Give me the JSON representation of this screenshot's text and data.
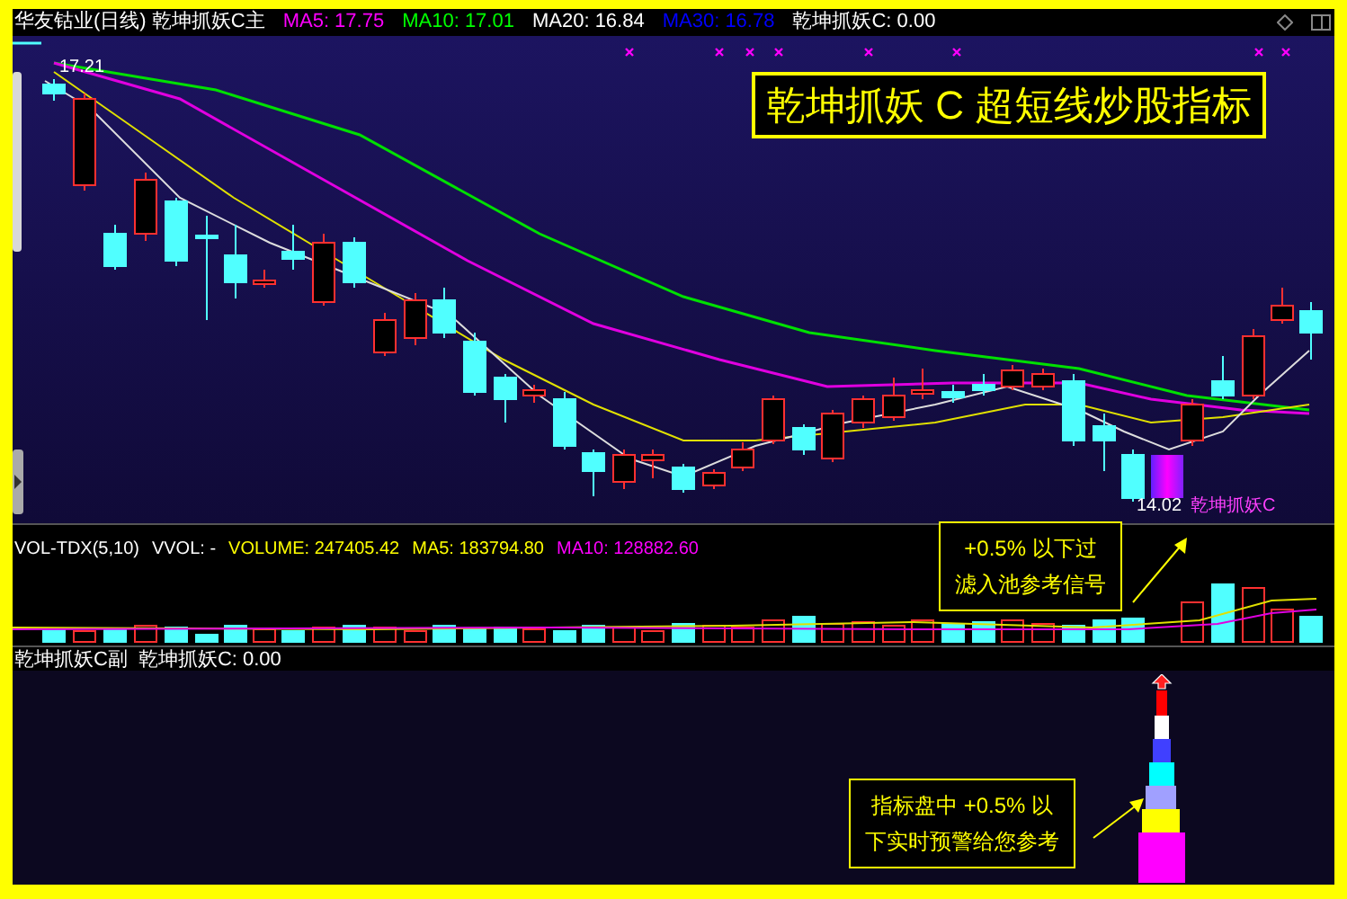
{
  "main_header": {
    "title": "华友钴业(日线) 乾坤抓妖C主",
    "indicators": [
      {
        "label": "MA5: 17.75",
        "color": "#ff00ff"
      },
      {
        "label": "MA10: 17.01",
        "color": "#00ff00"
      },
      {
        "label": "MA20: 16.84",
        "color": "#ffffff"
      },
      {
        "label": "MA30: 16.78",
        "color": "#0000ff"
      },
      {
        "label": "乾坤抓妖C: 0.00",
        "color": "#ffffff"
      }
    ]
  },
  "banner": "乾坤抓妖 C 超短线炒股指标",
  "price_labels": {
    "high": "17.21",
    "low": "14.02",
    "signal": "乾坤抓妖C"
  },
  "volume_header": [
    {
      "label": "VOL-TDX(5,10)",
      "color": "#ffffff"
    },
    {
      "label": "VVOL: -",
      "color": "#ffffff"
    },
    {
      "label": "VOLUME: 247405.42",
      "color": "#ffff00"
    },
    {
      "label": "MA5: 183794.80",
      "color": "#ffff00"
    },
    {
      "label": "MA10: 128882.60",
      "color": "#ff00ff"
    }
  ],
  "note_1": [
    "+0.5% 以下过",
    "滤入池参考信号"
  ],
  "sub_header": [
    "乾坤抓妖C副",
    "乾坤抓妖C: 0.00"
  ],
  "note_2": [
    "指标盘中 +0.5% 以",
    "下实时预警给您参考"
  ]
}
